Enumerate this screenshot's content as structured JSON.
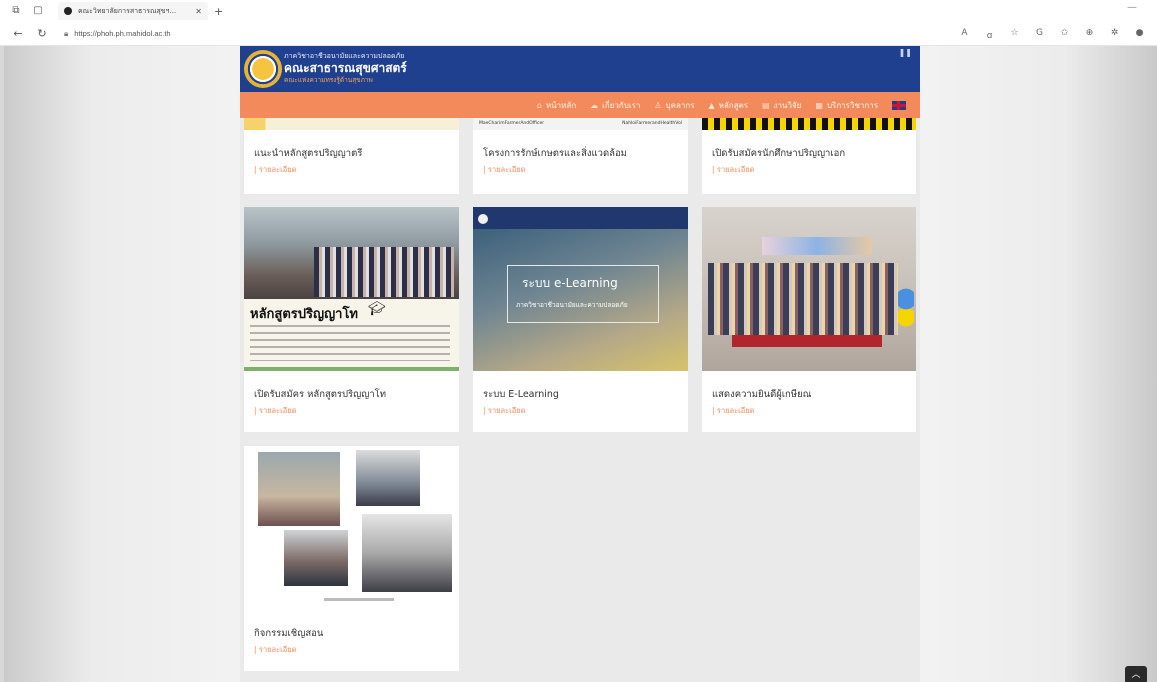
{
  "browser": {
    "tab_title": "คณะวิทยาลัยการสาธารณสุขฯ...",
    "url": "https://phoh.ph.mahidol.ac.th"
  },
  "site": {
    "title_line1": "ภาควิชาอาชีวอนามัยและความปลอดภัย",
    "title_main": "คณะสาธารณสุขศาสตร์",
    "title_line3": "คณะแห่งความทรงรู้ด้านสุขภาพ"
  },
  "menu": [
    {
      "label": "หน้าหลัก",
      "icon": "home-icon"
    },
    {
      "label": "เกี่ยวกับเรา",
      "icon": "chat-icon"
    },
    {
      "label": "บุคลากร",
      "icon": "person-icon"
    },
    {
      "label": "หลักสูตร",
      "icon": "graduation-icon"
    },
    {
      "label": "งานวิจัย",
      "icon": "document-icon"
    },
    {
      "label": "บริการวิชาการ",
      "icon": "grid-icon"
    }
  ],
  "cards": [
    {
      "title": "แนะนำหลักสูตรปริญญาตรี",
      "link": "| รายละเอียด"
    },
    {
      "title": "โครงการรักษ์เกษตรและสิ่งแวดล้อม",
      "link": "| รายละเอียด",
      "thumb_caption_left": "MaeCharimFarmerAndOfficer",
      "thumb_caption_right": "NahloiFarmerandHealthVol"
    },
    {
      "title": "เปิดรับสมัครนักศึกษาปริญญาเอก",
      "link": "| รายละเอียด"
    },
    {
      "title": "เปิดรับสมัคร หลักสูตรปริญญาโท",
      "link": "| รายละเอียด",
      "thumb_headline": "หลักสูตรปริญญาโท"
    },
    {
      "title": "ระบบ E-Learning",
      "link": "| รายละเอียด",
      "thumb_headline": "ระบบ e-Learning",
      "thumb_sub": "ภาควิชาอาชีวอนามัยและความปลอดภัย"
    },
    {
      "title": "แสดงความยินดีผู้เกษียณ",
      "link": "| รายละเอียด"
    },
    {
      "title": "กิจกรรมเชิญสอน",
      "link": "| รายละเอียด"
    }
  ],
  "colors": {
    "header_blue": "#1f3f8f",
    "menu_orange": "#f28a5c",
    "link_orange": "#f28a5c"
  }
}
